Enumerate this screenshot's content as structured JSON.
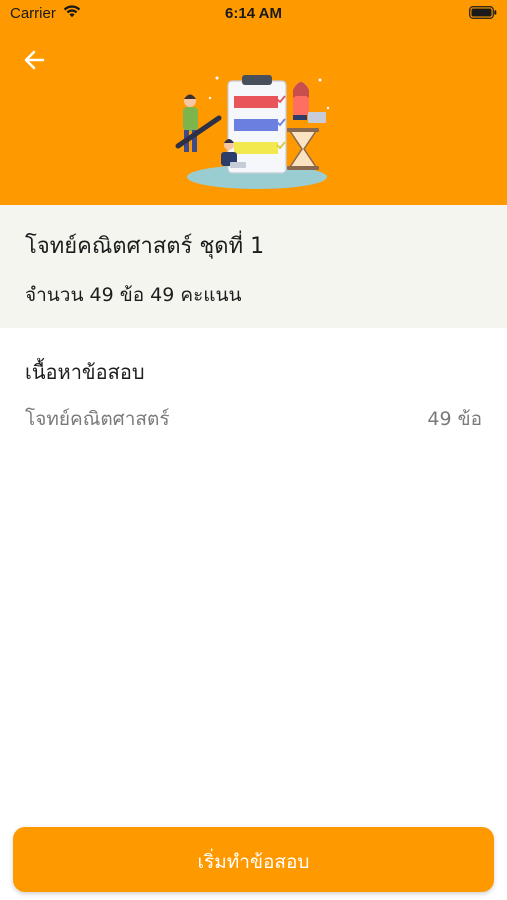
{
  "status_bar": {
    "carrier": "Carrier",
    "time": "6:14 AM",
    "wifi_icon": "wifi-icon",
    "battery_icon": "battery-icon"
  },
  "header": {
    "back_icon": "arrow-left-icon",
    "background_color": "#ff9900"
  },
  "quiz": {
    "title": "โจทย์คณิตศาสตร์ ชุดที่ 1",
    "count": "จำนวน 49 ข้อ 49 คะแนน"
  },
  "content": {
    "heading": "เนื้อหาข้อสอบ",
    "topics": [
      {
        "name": "โจทย์คณิตศาสตร์",
        "count": "49 ข้อ"
      }
    ]
  },
  "footer": {
    "start_label": "เริ่มทำข้อสอบ",
    "button_color": "#ff9900"
  }
}
